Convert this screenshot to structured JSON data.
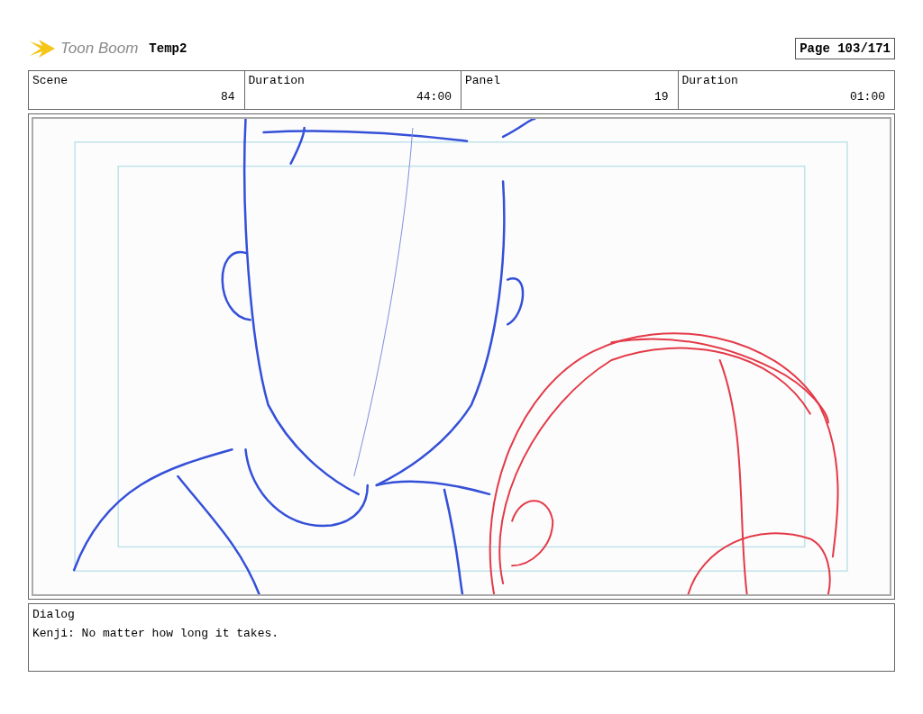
{
  "header": {
    "logo_text": "Toon Boom",
    "project": "Temp2",
    "page": "Page 103/171"
  },
  "fields": [
    {
      "label": "Scene",
      "value": "84"
    },
    {
      "label": "Duration",
      "value": "44:00"
    },
    {
      "label": "Panel",
      "value": "19"
    },
    {
      "label": "Duration",
      "value": "01:00"
    }
  ],
  "dialog": {
    "label": "Dialog",
    "text": "Kenji: No matter how long it takes."
  }
}
